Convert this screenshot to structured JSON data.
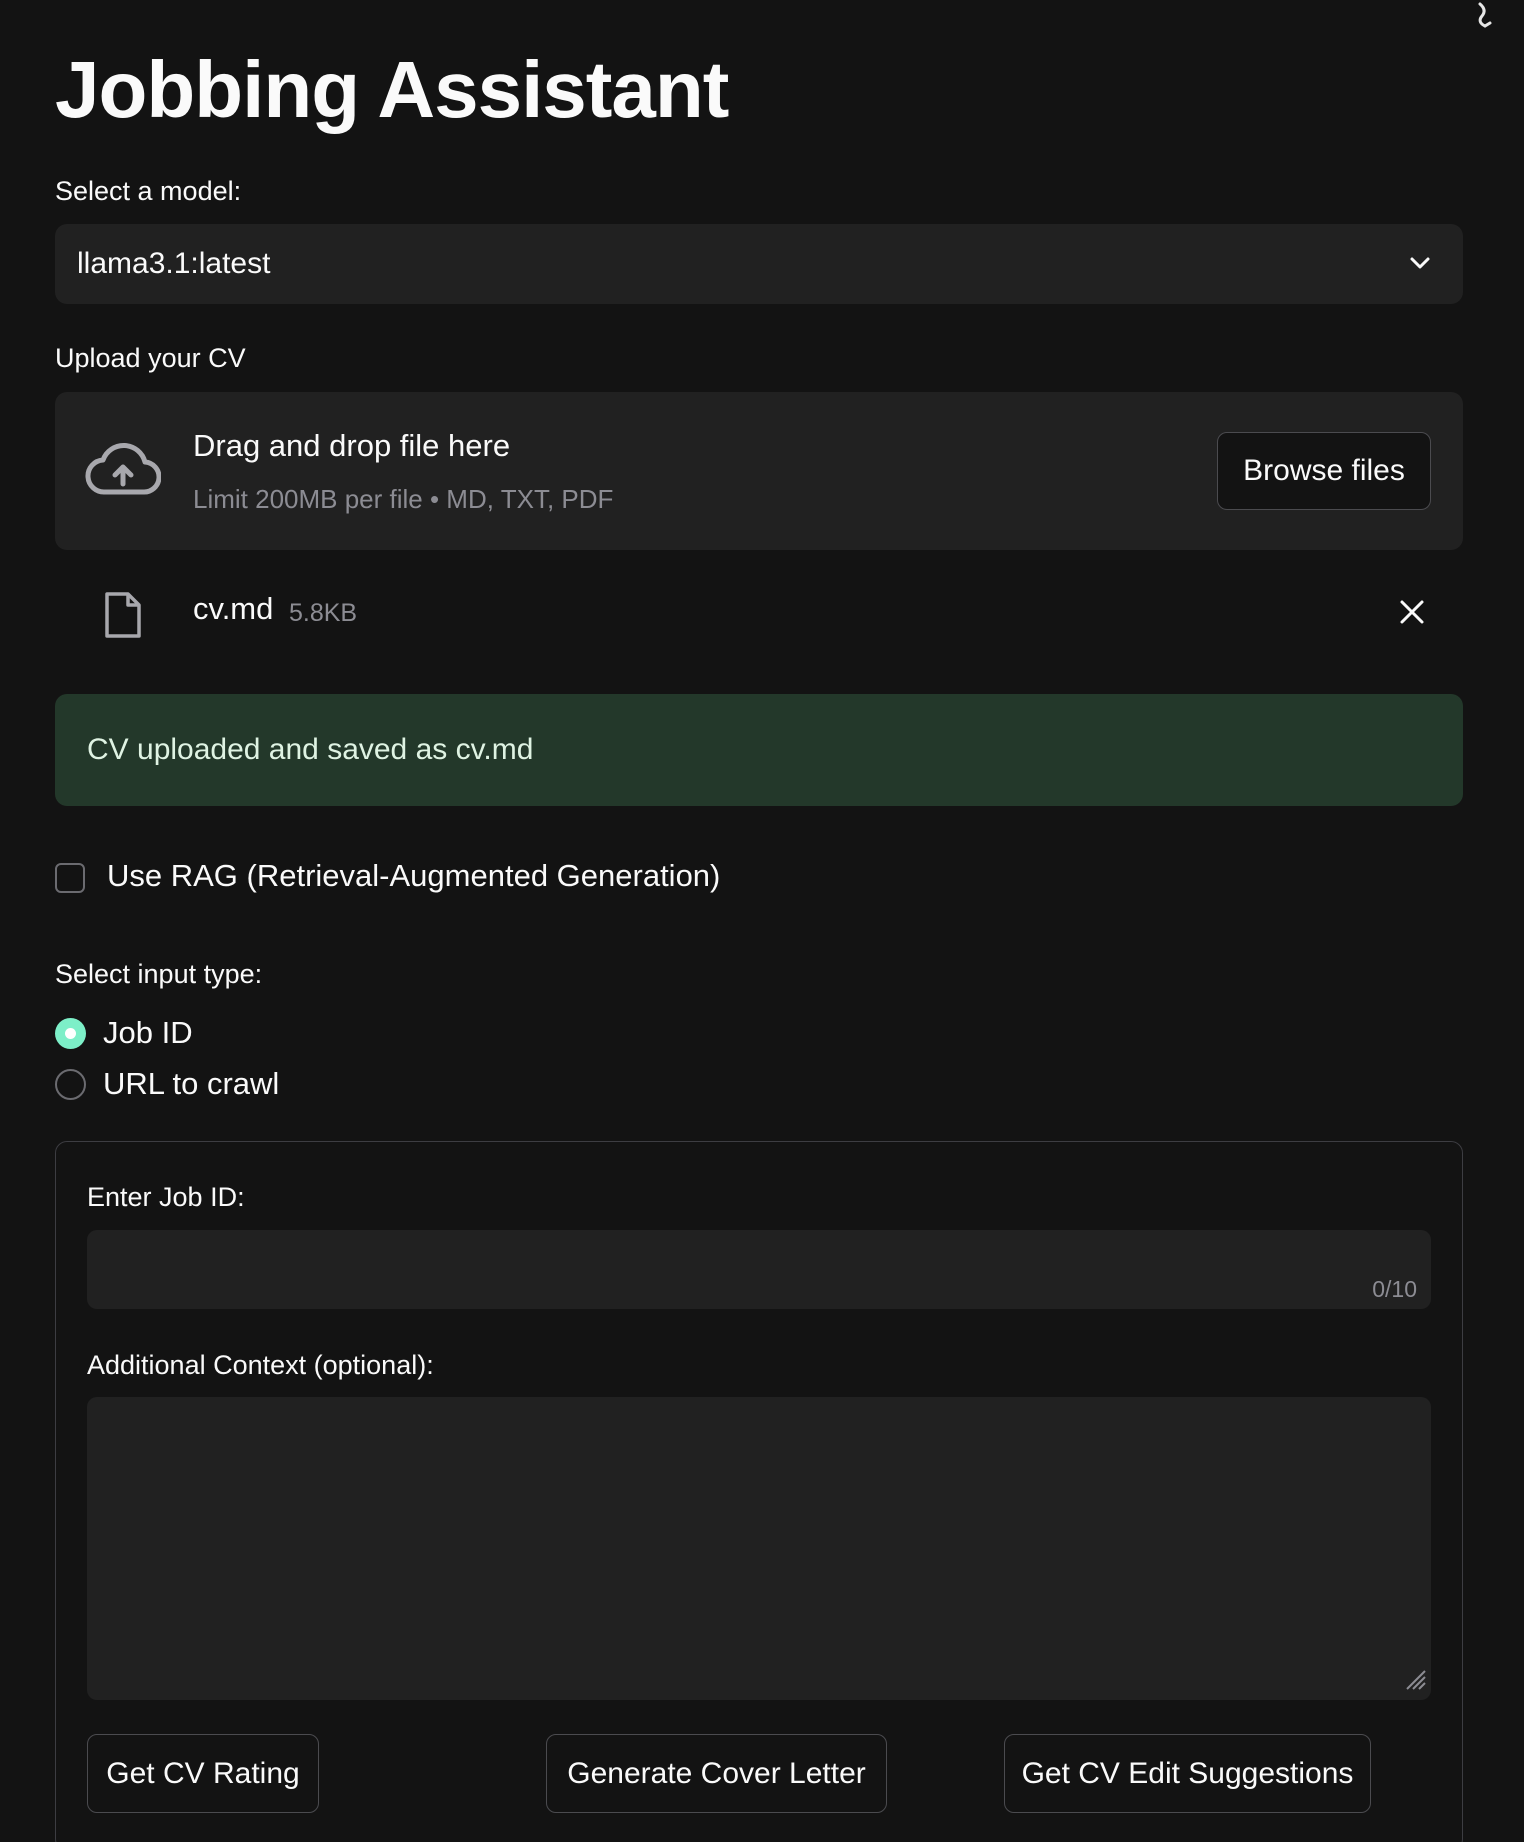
{
  "page": {
    "title": "Jobbing Assistant"
  },
  "model_select": {
    "label": "Select a model:",
    "value": "llama3.1:latest"
  },
  "uploader": {
    "label": "Upload your CV",
    "drop_text": "Drag and drop file here",
    "limit_text": "Limit 200MB per file • MD, TXT, PDF",
    "browse_label": "Browse files"
  },
  "uploaded_file": {
    "name": "cv.md",
    "size": "5.8KB"
  },
  "success_message": "CV uploaded and saved as cv.md",
  "rag_checkbox": {
    "label": "Use RAG (Retrieval-Augmented Generation)",
    "checked": false
  },
  "input_type": {
    "label": "Select input type:",
    "options": [
      {
        "label": "Job ID",
        "selected": true
      },
      {
        "label": "URL to crawl",
        "selected": false
      }
    ]
  },
  "form": {
    "job_id_label": "Enter Job ID:",
    "job_id_value": "",
    "job_id_counter": "0/10",
    "context_label": "Additional Context (optional):",
    "context_value": ""
  },
  "actions": {
    "cv_rating": "Get CV Rating",
    "cover_letter": "Generate Cover Letter",
    "cv_edit": "Get CV Edit Suggestions"
  },
  "colors": {
    "background": "#131313",
    "input_bg": "#212121",
    "success_bg": "#23382a",
    "radio_accent": "#7defc8"
  }
}
